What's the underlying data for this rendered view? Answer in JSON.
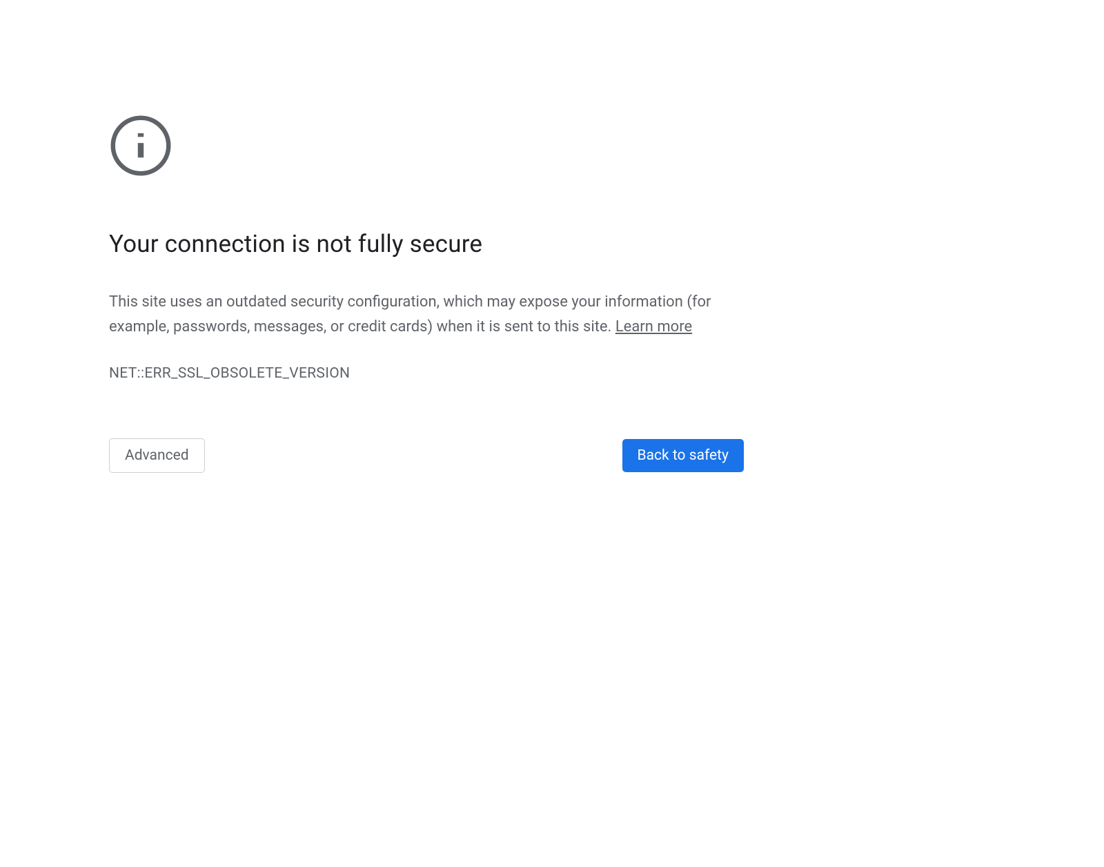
{
  "heading": "Your connection is not fully secure",
  "description_text": "This site uses an outdated security configuration, which may expose your information (for example, passwords, messages, or credit cards) when it is sent to this site. ",
  "learn_more_label": "Learn more",
  "error_code": "NET::ERR_SSL_OBSOLETE_VERSION",
  "buttons": {
    "advanced": "Advanced",
    "back_to_safety": "Back to safety"
  }
}
